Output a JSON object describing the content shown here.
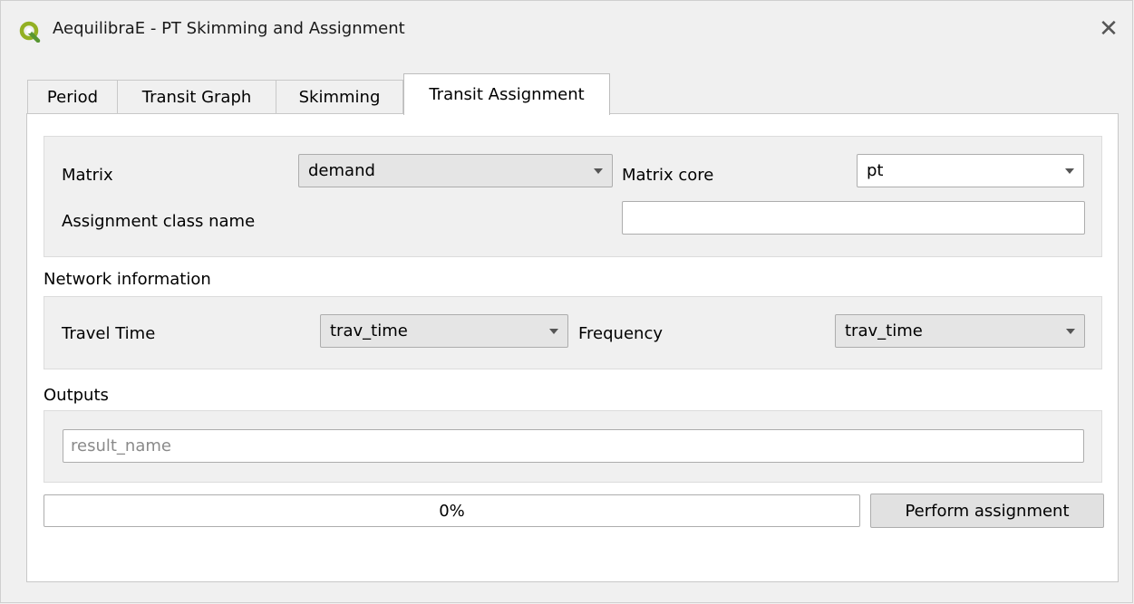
{
  "window": {
    "title": "AequilibraE - PT Skimming and Assignment",
    "close_glyph": "✕",
    "app_icon": "qgis-logo-icon"
  },
  "tabs": [
    {
      "label": "Period"
    },
    {
      "label": "Transit Graph"
    },
    {
      "label": "Skimming"
    },
    {
      "label": "Transit Assignment",
      "active": true
    }
  ],
  "matrix": {
    "label": "Matrix",
    "value": "demand",
    "core_label": "Matrix core",
    "core_value": "pt",
    "class_name_label": "Assignment class name",
    "class_name_value": ""
  },
  "network": {
    "title": "Network information",
    "travel_time_label": "Travel Time",
    "travel_time_value": "trav_time",
    "frequency_label": "Frequency",
    "frequency_value": "trav_time"
  },
  "outputs": {
    "title": "Outputs",
    "result_placeholder": "result_name",
    "result_value": ""
  },
  "progress": {
    "text": "0%",
    "fraction": 0
  },
  "actions": {
    "perform_label": "Perform assignment"
  },
  "colors": {
    "accent": "#06b025",
    "qgis_green": "#93b023"
  }
}
